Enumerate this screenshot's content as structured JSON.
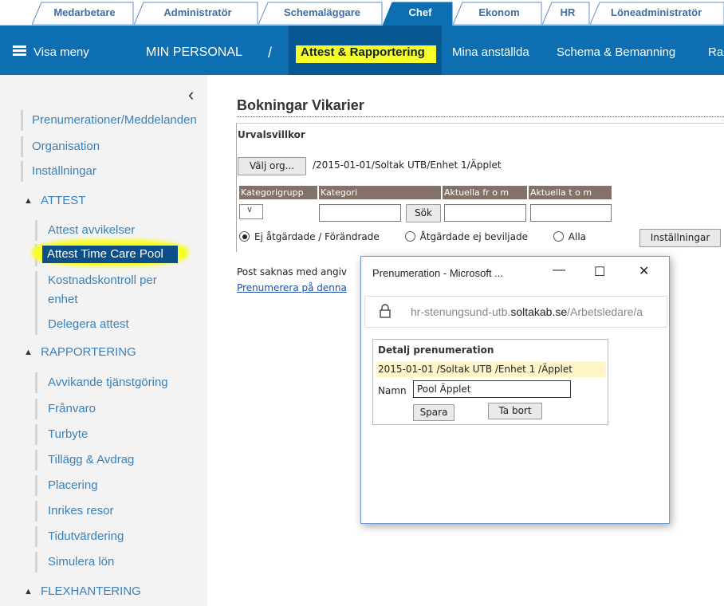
{
  "role_tabs": [
    "Medarbetare",
    "Administratör",
    "Schemaläggare",
    "Chef",
    "Ekonom",
    "HR",
    "Löneadministratör"
  ],
  "topbar": {
    "menu_label": "Visa meny",
    "section": "MIN PERSONAL",
    "separator": "/",
    "active": "Attest & Rapportering",
    "items": [
      "Mina anställda",
      "Schema & Bemanning",
      "Ra"
    ]
  },
  "sidebar": {
    "collapse": "‹",
    "top_links": [
      "Prenumerationer/Meddelanden",
      "Organisation",
      "Inställningar"
    ],
    "attest": {
      "title": "ATTEST",
      "items": [
        "Attest avvikelser",
        "Attest Time Care Pool",
        "Kostnadskontroll per",
        "enhet",
        "Delegera attest"
      ]
    },
    "rapportering": {
      "title": "RAPPORTERING",
      "items": [
        "Avvikande tjänstgöring",
        "Frånvaro",
        "Turbyte",
        "Tillägg & Avdrag",
        "Placering",
        "Inrikes resor",
        "Tidutvärdering",
        "Simulera lön"
      ]
    },
    "flex": {
      "title": "FLEXHANTERING"
    }
  },
  "main": {
    "title": "Bokningar Vikarier",
    "urval_title": "Urvalsvillkor",
    "valj_org": "Välj org...",
    "org_path": "/2015-01-01/Soltak UTB/Enhet 1/Äpplet",
    "headers": [
      "Kategorigrupp",
      "Kategori",
      "Aktuella fr o m",
      "Aktuella t o m"
    ],
    "sok": "Sök",
    "radios": [
      "Ej åtgärdade / Förändrade",
      "Åtgärdade ej beviljade",
      "Alla"
    ],
    "installningar": "Inställningar",
    "post_text": "Post saknas med angiv",
    "pren_link": "Prenumerera på denna"
  },
  "popup": {
    "title": "Prenumeration - Microsoft ...",
    "url_pre": "hr-stenungsund-utb.",
    "url_domain": "soltakab.se",
    "url_post": "/Arbetsledare/a",
    "detalj_title": "Detalj prenumeration",
    "path": "2015-01-01 /Soltak UTB /Enhet 1 /Äpplet",
    "namn_label": "Namn",
    "namn_value": "Pool Äpplet",
    "spara": "Spara",
    "ta_bort": "Ta bort"
  }
}
